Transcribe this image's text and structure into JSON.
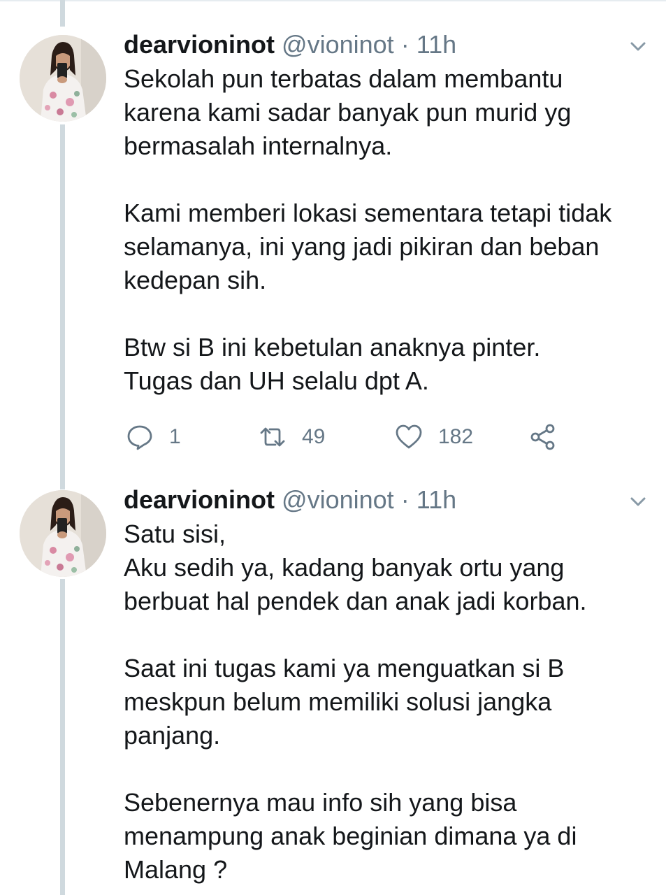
{
  "tweets": [
    {
      "name": "dearvioninot",
      "handle": "@vioninot",
      "separator": "·",
      "time": "11h",
      "paragraphs": [
        "Sekolah pun terbatas dalam membantu\nkarena kami sadar banyak pun murid yg\nbermasalah internalnya.",
        "Kami memberi lokasi sementara tetapi tidak\nselamanya, ini yang jadi pikiran dan beban\nkedepan sih.",
        "Btw si B ini kebetulan anaknya pinter.\nTugas dan UH selalu dpt A."
      ],
      "actions": {
        "reply_count": "1",
        "retweet_count": "49",
        "like_count": "182"
      }
    },
    {
      "name": "dearvioninot",
      "handle": "@vioninot",
      "separator": "·",
      "time": "11h",
      "paragraphs": [
        "Satu sisi,\nAku sedih ya, kadang banyak ortu yang\nberbuat hal pendek dan anak jadi korban.",
        "Saat ini tugas kami ya menguatkan si B\nmeskpun belum memiliki solusi jangka\npanjang.",
        "Sebenernya mau info sih yang bisa\nmenampung anak beginian dimana ya di\nMalang ?"
      ]
    }
  ],
  "icons": {
    "reply": "speech-bubble-icon",
    "retweet": "retweet-arrows-icon",
    "like": "heart-icon",
    "share": "share-nodes-icon",
    "more": "chevron-down-icon"
  },
  "colors": {
    "text": "#14171a",
    "secondary": "#657786",
    "thread_line": "#cfd9de"
  }
}
